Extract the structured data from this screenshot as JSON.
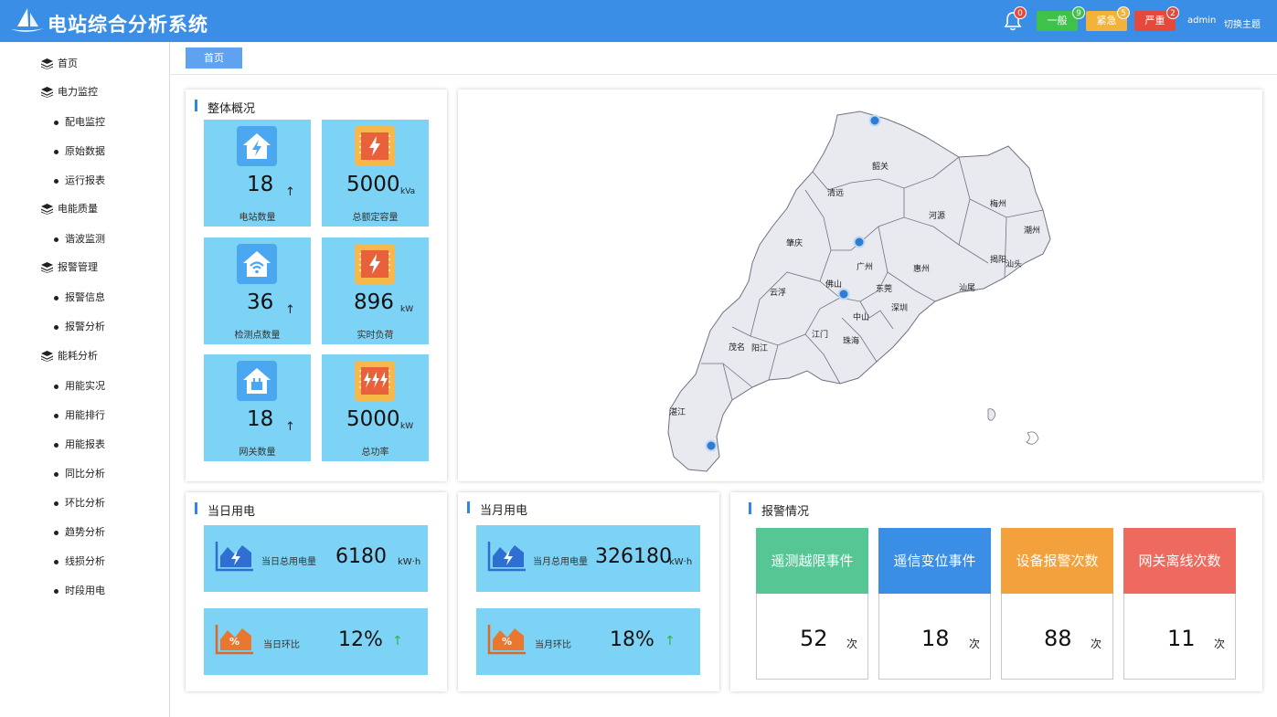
{
  "header": {
    "title": "电站综合分析系统",
    "bell_count": "0",
    "alarms": [
      {
        "label": "一般",
        "count": "9",
        "color": "#3ec24a",
        "badge_color": "#3ec24a"
      },
      {
        "label": "紧急",
        "count": "5",
        "color": "#f3b339",
        "badge_color": "#f3b339"
      },
      {
        "label": "严重",
        "count": "2",
        "color": "#e4493b",
        "badge_color": "#e4493b"
      }
    ],
    "user": "admin",
    "switch_theme": "切换主题"
  },
  "sidebar": {
    "items": [
      {
        "label": "首页",
        "type": "group"
      },
      {
        "label": "电力监控",
        "type": "group"
      },
      {
        "label": "配电监控",
        "type": "sub"
      },
      {
        "label": "原始数据",
        "type": "sub"
      },
      {
        "label": "运行报表",
        "type": "sub"
      },
      {
        "label": "电能质量",
        "type": "group"
      },
      {
        "label": "谐波监测",
        "type": "sub"
      },
      {
        "label": "报警管理",
        "type": "group"
      },
      {
        "label": "报警信息",
        "type": "sub"
      },
      {
        "label": "报警分析",
        "type": "sub"
      },
      {
        "label": "能耗分析",
        "type": "group"
      },
      {
        "label": "用能实况",
        "type": "sub"
      },
      {
        "label": "用能排行",
        "type": "sub"
      },
      {
        "label": "用能报表",
        "type": "sub"
      },
      {
        "label": "同比分析",
        "type": "sub"
      },
      {
        "label": "环比分析",
        "type": "sub"
      },
      {
        "label": "趋势分析",
        "type": "sub"
      },
      {
        "label": "线损分析",
        "type": "sub"
      },
      {
        "label": "时段用电",
        "type": "sub"
      }
    ]
  },
  "tabs": [
    {
      "label": "首页"
    }
  ],
  "overview": {
    "title": "整体概况",
    "cards": [
      {
        "value": "18",
        "unit": "",
        "arrow": "↑",
        "label": "电站数量",
        "icon": "house-bolt-icon"
      },
      {
        "value": "5000",
        "unit": "kVa",
        "arrow": "",
        "label": "总额定容量",
        "icon": "capacity-bolt-icon"
      },
      {
        "value": "36",
        "unit": "",
        "arrow": "↑",
        "label": "检测点数量",
        "icon": "house-wifi-icon"
      },
      {
        "value": "896",
        "unit": "kW",
        "arrow": "",
        "label": "实时负荷",
        "icon": "load-bolt-icon"
      },
      {
        "value": "18",
        "unit": "",
        "arrow": "↑",
        "label": "网关数量",
        "icon": "house-gateway-icon"
      },
      {
        "value": "5000",
        "unit": "kW",
        "arrow": "",
        "label": "总功率",
        "icon": "power-bolts-icon"
      }
    ]
  },
  "map": {
    "cities": [
      "韶关",
      "清远",
      "河源",
      "梅州",
      "潮州",
      "肇庆",
      "广州",
      "惠州",
      "揭阳",
      "汕头",
      "佛山",
      "云浮",
      "东莞",
      "汕尾",
      "深圳",
      "中山",
      "江门",
      "茂名",
      "阳江",
      "珠海",
      "湛江"
    ]
  },
  "daily": {
    "title": "当日用电",
    "total_label": "当日总用电量",
    "total_value": "6180",
    "total_unit": "kW·h",
    "ratio_label": "当日环比",
    "ratio_value": "12%",
    "ratio_arrow": "↑"
  },
  "monthly": {
    "title": "当月用电",
    "total_label": "当月总用电量",
    "total_value": "326180",
    "total_unit": "kW·h",
    "ratio_label": "当月环比",
    "ratio_value": "18%",
    "ratio_arrow": "↑"
  },
  "alarm_panel": {
    "title": "报警情况",
    "items": [
      {
        "label": "遥测越限事件",
        "value": "52",
        "unit": "次",
        "color": "#55c694"
      },
      {
        "label": "遥信变位事件",
        "value": "18",
        "unit": "次",
        "color": "#3a8ee6"
      },
      {
        "label": "设备报警次数",
        "value": "88",
        "unit": "次",
        "color": "#f2a13d"
      },
      {
        "label": "网关离线次数",
        "value": "11",
        "unit": "次",
        "color": "#ef6a5e"
      }
    ]
  }
}
